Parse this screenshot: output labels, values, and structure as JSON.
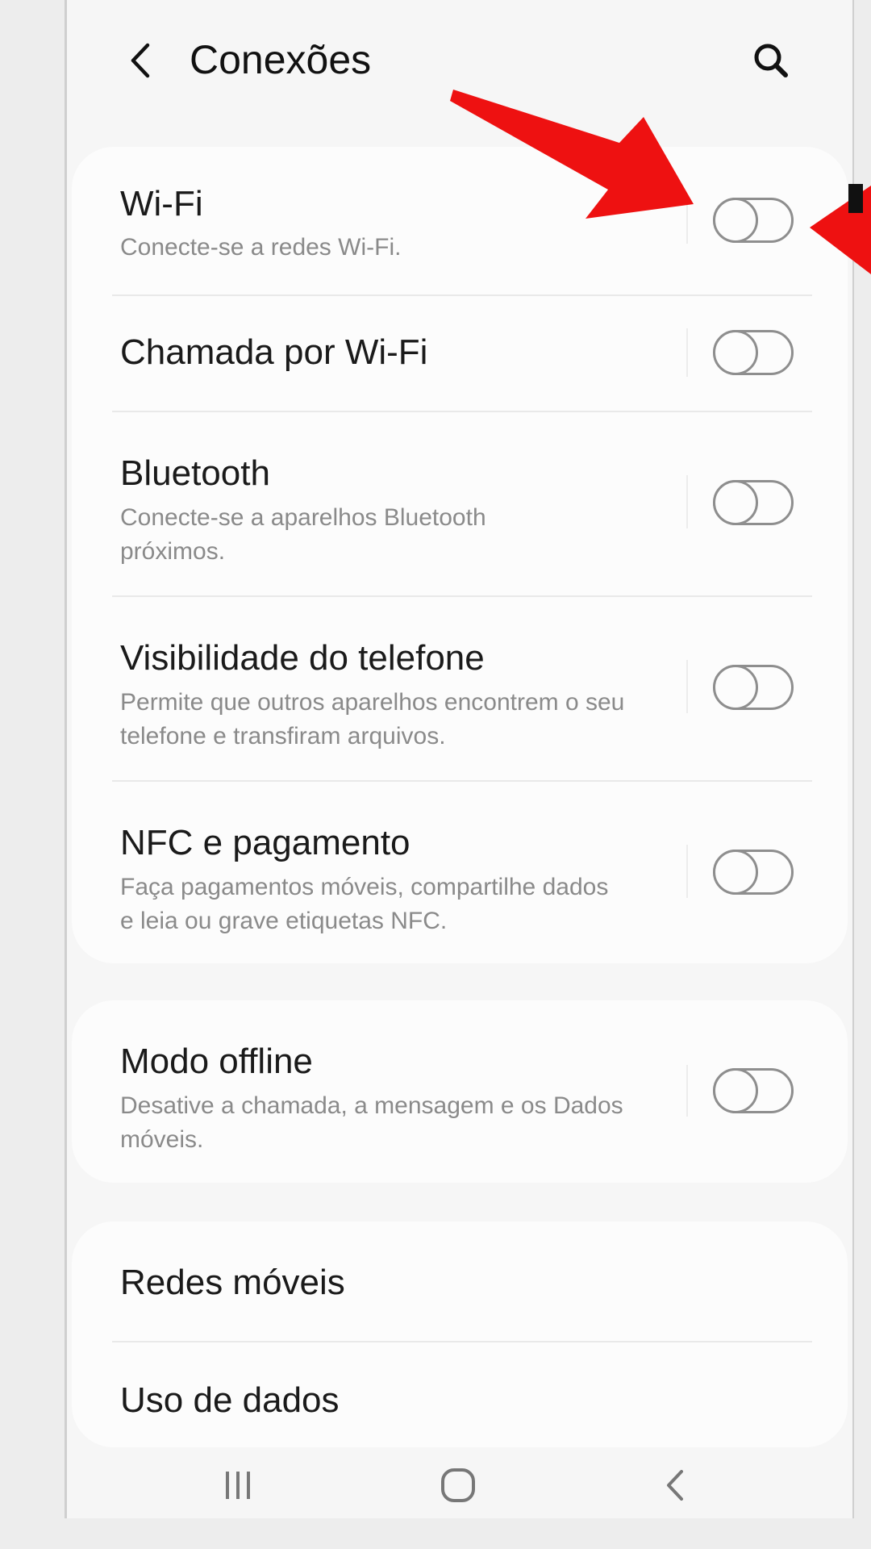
{
  "header": {
    "title": "Conexões",
    "back_icon": "chevron-left-icon",
    "search_icon": "search-icon"
  },
  "settings": [
    {
      "id": "wifi",
      "title": "Wi-Fi",
      "subtitle": "Conecte-se a redes Wi-Fi.",
      "toggle": "off"
    },
    {
      "id": "wifi-calling",
      "title": "Chamada por Wi-Fi",
      "subtitle": "",
      "toggle": "off"
    },
    {
      "id": "bluetooth",
      "title": "Bluetooth",
      "subtitle": "Conecte-se a aparelhos Bluetooth próximos.",
      "toggle": "off"
    },
    {
      "id": "phone-visibility",
      "title": "Visibilidade do telefone",
      "subtitle": "Permite que outros aparelhos encontrem o seu telefone e transfiram arquivos.",
      "toggle": "off"
    },
    {
      "id": "nfc",
      "title": "NFC e pagamento",
      "subtitle": "Faça pagamentos móveis, compartilhe dados e leia ou grave etiquetas NFC.",
      "toggle": "off"
    },
    {
      "id": "airplane",
      "title": "Modo offline",
      "subtitle": "Desative a chamada, a mensagem e os Dados móveis.",
      "toggle": "off"
    },
    {
      "id": "mobile-networks",
      "title": "Redes móveis"
    },
    {
      "id": "data-usage",
      "title": "Uso de dados"
    }
  ],
  "navbar": {
    "recents_icon": "recents-icon",
    "home_icon": "home-icon",
    "back_icon": "back-nav-icon"
  },
  "annotations": {
    "arrow_color": "#ee1111"
  }
}
